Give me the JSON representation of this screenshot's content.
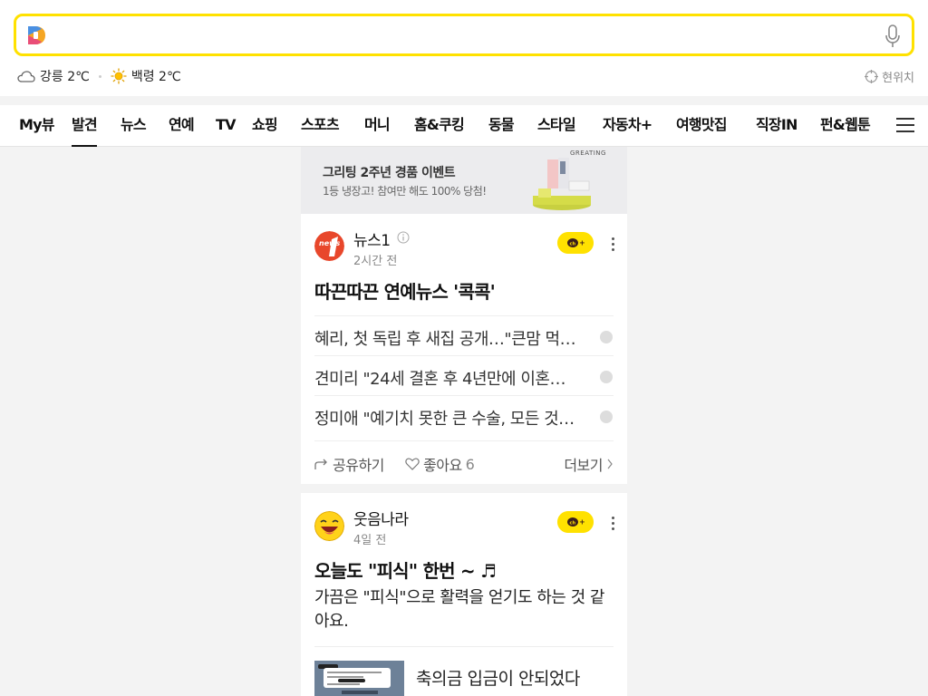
{
  "weather": [
    {
      "icon": "cloud-icon",
      "text": "강릉 2℃"
    },
    {
      "icon": "sun-icon",
      "text": "백령 2℃"
    }
  ],
  "location": {
    "label": "현위치"
  },
  "nav": {
    "items": [
      "My뷰",
      "발견",
      "뉴스",
      "연예",
      "TV",
      "쇼핑",
      "스포츠",
      "머니",
      "홈&쿠킹",
      "동물",
      "스타일",
      "자동차+",
      "여행맛집",
      "직장IN",
      "펀&웹툰"
    ],
    "active_index": 1
  },
  "banner": {
    "title": "그리팅 2주년 경품 이벤트",
    "subtitle": "1등 냉장고! 참여만 해도 100% 당첨!",
    "brand": "GREATING"
  },
  "card1": {
    "source": "뉴스1",
    "time": "2시간 전",
    "headline": "따끈따끈 연예뉴스 '콕콕'",
    "items": [
      "혜리, 첫 독립 후 새집 공개…\"큰맘 먹고…",
      "견미리 \"24세 결혼 후 4년만에 이혼…",
      "정미애 \"예기치 못한 큰 수술, 모든 것…"
    ],
    "share_label": "공유하기",
    "like_label": "좋아요",
    "like_count": "6",
    "more_label": "더보기"
  },
  "card2": {
    "source": "웃음나라",
    "time": "4일 전",
    "headline": "오늘도 \"피식\" 한번 ~ ♬",
    "description": "가끔은 \"피식\"으로 활력을 얻기도 하는 것 같아요.",
    "thumb_title": "축의금 입금이 안되었다"
  },
  "colors": {
    "accent": "#ffe100",
    "news1": "#e8472b"
  }
}
